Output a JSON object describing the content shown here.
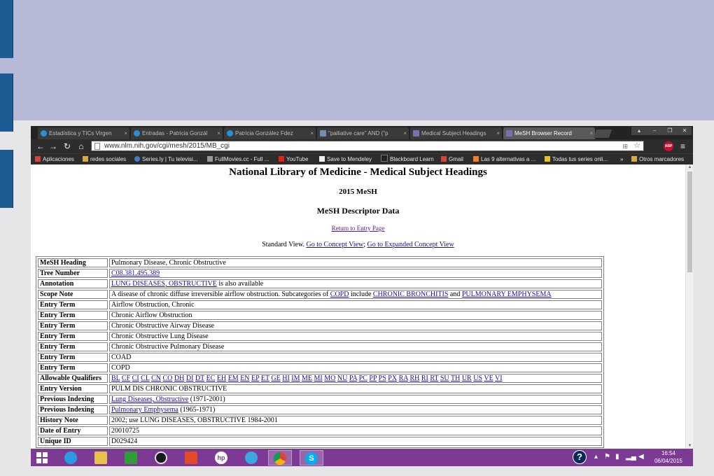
{
  "browser": {
    "tabs": [
      {
        "label": "Estadística y TICs Virgen",
        "active": false
      },
      {
        "label": "Entradas - Patricia Gonzál",
        "active": false
      },
      {
        "label": "Patricia González Fdez",
        "active": false
      },
      {
        "label": "\"palliative care\" AND (\"p",
        "active": false
      },
      {
        "label": "Medical Subject Headings",
        "active": false
      },
      {
        "label": "MeSH Browser Record",
        "active": true
      }
    ],
    "close_glyph": "×",
    "url": "www.nlm.nih.gov/cgi/mesh/2015/MB_cgi",
    "abp_label": "ABP",
    "bookmarks": [
      "Aplicaciones",
      "redes sociales",
      "Series.ly | Tu televisi...",
      "FullMovies.cc - Full ...",
      "YouTube",
      "Save to Mendeley",
      "Blackboard Learn",
      "Gmail",
      "Las 9 alternativas a ...",
      "Todas tus series onli..."
    ],
    "bookmarks_overflow": "»",
    "other_bookmarks": "Otros marcadores"
  },
  "page": {
    "title": "National Library of Medicine - Medical Subject Headings",
    "year_heading": "2015 MeSH",
    "section_heading": "MeSH Descriptor Data",
    "return_link": "Return to Entry Page",
    "view_prefix": "Standard View.",
    "concept_view_link": "Go to Concept View",
    "view_separator": ";",
    "expanded_view_link": "Go to Expanded Concept View"
  },
  "record": {
    "mesh_heading": {
      "label": "MeSH Heading",
      "value": "Pulmonary Disease, Chronic Obstructive"
    },
    "tree_number": {
      "label": "Tree Number",
      "link": "C08.381.495.389"
    },
    "annotation": {
      "label": "Annotation",
      "link": "LUNG DISEASES, OBSTRUCTIVE",
      "suffix": " is also available"
    },
    "scope_note": {
      "label": "Scope Note",
      "text_before": "A disease of chronic diffuse irreversible airflow obstruction. Subcategories of ",
      "link1": "COPD",
      "text_middle": " include ",
      "link2": "CHRONIC BRONCHITIS",
      "text_and": " and ",
      "link3": "PULMONARY EMPHYSEMA"
    },
    "entry_terms": [
      {
        "label": "Entry Term",
        "value": "Airflow Obstruction, Chronic"
      },
      {
        "label": "Entry Term",
        "value": "Chronic Airflow Obstruction"
      },
      {
        "label": "Entry Term",
        "value": "Chronic Obstructive Airway Disease"
      },
      {
        "label": "Entry Term",
        "value": "Chronic Obstructive Lung Disease"
      },
      {
        "label": "Entry Term",
        "value": "Chronic Obstructive Pulmonary Disease"
      },
      {
        "label": "Entry Term",
        "value": "COAD"
      },
      {
        "label": "Entry Term",
        "value": "COPD"
      }
    ],
    "qualifiers": {
      "label": "Allowable Qualifiers",
      "items": [
        "BL",
        "CF",
        "CI",
        "CL",
        "CN",
        "CO",
        "DH",
        "DI",
        "DT",
        "EC",
        "EH",
        "EM",
        "EN",
        "EP",
        "ET",
        "GE",
        "HI",
        "IM",
        "ME",
        "MI",
        "MO",
        "NU",
        "PA",
        "PC",
        "PP",
        "PS",
        "PX",
        "RA",
        "RH",
        "RI",
        "RT",
        "SU",
        "TH",
        "UR",
        "US",
        "VE",
        "VI"
      ]
    },
    "entry_version": {
      "label": "Entry Version",
      "value": "PULM DIS CHRONIC OBSTRUCTIVE"
    },
    "previous_indexing_1": {
      "label": "Previous Indexing",
      "link": "Lung Diseases, Obstructive",
      "suffix": " (1971-2001)"
    },
    "previous_indexing_2": {
      "label": "Previous Indexing",
      "link": "Pulmonary Emphysema",
      "suffix": " (1965-1971)"
    },
    "history_note": {
      "label": "History Note",
      "value": "2002; use LUNG DISEASES, OBSTRUCTIVE 1984-2001"
    },
    "date_of_entry": {
      "label": "Date of Entry",
      "value": "20010725"
    },
    "unique_id": {
      "label": "Unique ID",
      "value": "D029424"
    }
  },
  "taskbar": {
    "help_glyph": "?",
    "tray_chevron": "▴",
    "time": "16:54",
    "date": "06/04/2015",
    "hp_label": "hp"
  }
}
